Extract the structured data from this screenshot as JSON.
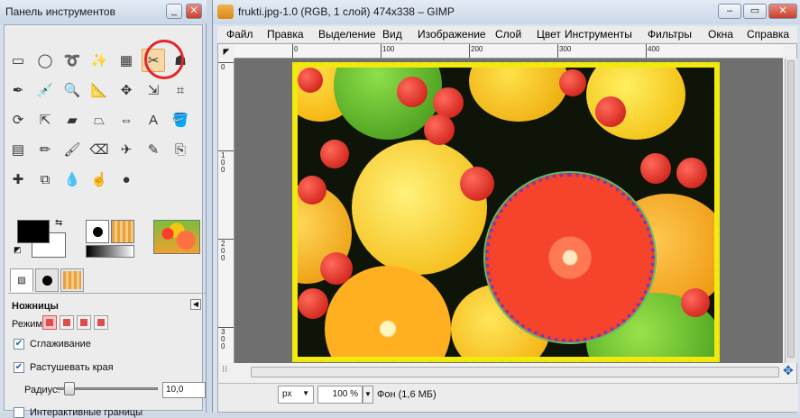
{
  "toolbox": {
    "title": "Панель инструментов",
    "minimize": "_",
    "close": "✕"
  },
  "tools": [
    {
      "name": "rect-select-icon",
      "glyph": "▭"
    },
    {
      "name": "ellipse-select-icon",
      "glyph": "◯"
    },
    {
      "name": "free-select-icon",
      "glyph": "➰"
    },
    {
      "name": "fuzzy-select-icon",
      "glyph": "✨"
    },
    {
      "name": "color-select-icon",
      "glyph": "▦"
    },
    {
      "name": "scissors-icon",
      "glyph": "✂"
    },
    {
      "name": "foreground-select-icon",
      "glyph": "☗"
    },
    {
      "name": "paths-icon",
      "glyph": "✒"
    },
    {
      "name": "color-picker-icon",
      "glyph": "💉"
    },
    {
      "name": "zoom-icon",
      "glyph": "🔍"
    },
    {
      "name": "measure-icon",
      "glyph": "📐"
    },
    {
      "name": "move-icon",
      "glyph": "✥"
    },
    {
      "name": "align-icon",
      "glyph": "⇲"
    },
    {
      "name": "crop-icon",
      "glyph": "⌗"
    },
    {
      "name": "rotate-icon",
      "glyph": "⟳"
    },
    {
      "name": "scale-icon",
      "glyph": "⇱"
    },
    {
      "name": "shear-icon",
      "glyph": "▰"
    },
    {
      "name": "perspective-icon",
      "glyph": "⏢"
    },
    {
      "name": "flip-icon",
      "glyph": "⇔"
    },
    {
      "name": "text-icon",
      "glyph": "A"
    },
    {
      "name": "bucket-fill-icon",
      "glyph": "🪣"
    },
    {
      "name": "blend-icon",
      "glyph": "▤"
    },
    {
      "name": "pencil-icon",
      "glyph": "✏"
    },
    {
      "name": "paintbrush-icon",
      "glyph": "🖌"
    },
    {
      "name": "eraser-icon",
      "glyph": "⌫"
    },
    {
      "name": "airbrush-icon",
      "glyph": "✈"
    },
    {
      "name": "ink-icon",
      "glyph": "✎"
    },
    {
      "name": "clone-icon",
      "glyph": "⎘"
    },
    {
      "name": "heal-icon",
      "glyph": "✚"
    },
    {
      "name": "perspective-clone-icon",
      "glyph": "⧉"
    },
    {
      "name": "blur-icon",
      "glyph": "💧"
    },
    {
      "name": "smudge-icon",
      "glyph": "☝"
    },
    {
      "name": "dodge-burn-icon",
      "glyph": "●"
    }
  ],
  "options": {
    "heading": "Ножницы",
    "mode_label": "Режим:",
    "antialiasing": "Сглаживание",
    "feather_edges": "Растушевать края",
    "radius_label": "Радиус:",
    "radius_value": "10,0",
    "interactive_boundary": "Интерактивные границы"
  },
  "image_window": {
    "title": "frukti.jpg-1.0 (RGB, 1 слой) 474x338 – GIMP",
    "minimize": "–",
    "maximize": "▭",
    "close": "✕",
    "menu": [
      "Файл",
      "Правка",
      "Выделение",
      "Вид",
      "Изображение",
      "Слой",
      "Цвет",
      "Инструменты",
      "Фильтры",
      "Окна",
      "Справка"
    ],
    "ruler_top": [
      "0",
      "100",
      "200",
      "300",
      "400"
    ],
    "ruler_left": [
      "0",
      "100",
      "200",
      "300"
    ],
    "unit": "px",
    "zoom": "100 %",
    "status": "Фон (1,6 МБ)"
  },
  "colors": {
    "accent_highlight": "#e2262b",
    "selection_dashes": "#e7e70a"
  }
}
